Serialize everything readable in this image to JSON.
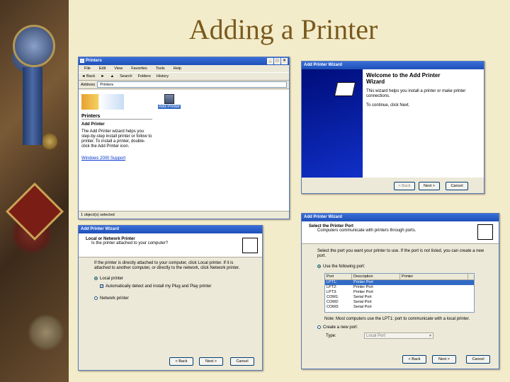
{
  "slide": {
    "title": "Adding a Printer"
  },
  "printers_window": {
    "title": "Printers",
    "menu": [
      "File",
      "Edit",
      "View",
      "Favorites",
      "Tools",
      "Help"
    ],
    "toolbar": {
      "back": "Back",
      "search": "Search",
      "folders": "Folders",
      "history": "History"
    },
    "address_label": "Address",
    "address_value": "Printers",
    "item_label": "Add Printer",
    "panel_heading": "Printers",
    "panel_subheading": "Add Printer",
    "panel_text": "The Add Printer wizard helps you step-by-step install printer or follow to printer. To install a printer, double-click the Add Printer icon.",
    "panel_link": "Windows 2000 Support",
    "status": "1 object(s) selected"
  },
  "welcome_wizard": {
    "title": "Add Printer Wizard",
    "heading": "Welcome to the Add Printer Wizard",
    "body": "This wizard helps you install a printer or make printer connections.",
    "next_prompt": "To continue, click Next.",
    "back": "< Back",
    "next": "Next >",
    "cancel": "Cancel"
  },
  "local_wizard": {
    "title": "Add Printer Wizard",
    "heading": "Local or Network Printer",
    "subheading": "Is the printer attached to your computer?",
    "body": "If the printer is directly attached to your computer, click Local printer. If it is attached to another computer, or directly to the network, click Network printer.",
    "opt_local": "Local printer",
    "opt_autodetect": "Automatically detect and install my Plug and Play printer",
    "opt_network": "Network printer",
    "back": "< Back",
    "next": "Next >",
    "cancel": "Cancel"
  },
  "port_wizard": {
    "title": "Add Printer Wizard",
    "heading": "Select the Printer Port",
    "subheading": "Computers communicate with printers through ports.",
    "body": "Select the port you want your printer to use. If the port is not listed, you can create a new port.",
    "opt_use": "Use the following port:",
    "columns": [
      "Port",
      "Description",
      "Printer"
    ],
    "rows": [
      {
        "port": "LPT1:",
        "desc": "Printer Port",
        "printer": ""
      },
      {
        "port": "LPT2:",
        "desc": "Printer Port",
        "printer": ""
      },
      {
        "port": "LPT3:",
        "desc": "Printer Port",
        "printer": ""
      },
      {
        "port": "COM1:",
        "desc": "Serial Port",
        "printer": ""
      },
      {
        "port": "COM2:",
        "desc": "Serial Port",
        "printer": ""
      },
      {
        "port": "COM3:",
        "desc": "Serial Port",
        "printer": ""
      }
    ],
    "note": "Note: Most computers use the LPT1: port to communicate with a local printer.",
    "opt_create": "Create a new port:",
    "type_label": "Type:",
    "type_value": "Local Port",
    "back": "< Back",
    "next": "Next >",
    "cancel": "Cancel"
  }
}
